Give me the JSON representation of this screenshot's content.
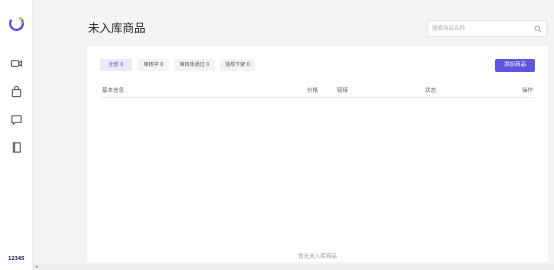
{
  "sidebar": {
    "nav": [
      {
        "icon": "video-icon"
      },
      {
        "icon": "shopping-bag-icon"
      },
      {
        "icon": "message-icon"
      },
      {
        "icon": "book-icon"
      }
    ],
    "avatar_text": "12345"
  },
  "header": {
    "title": "未入库商品",
    "search_placeholder": "搜索商品名称"
  },
  "tabs": [
    {
      "label": "全部 0",
      "active": true
    },
    {
      "label": "审核中 0",
      "active": false
    },
    {
      "label": "审核未通过 0",
      "active": false
    },
    {
      "label": "违规下架 0",
      "active": false
    }
  ],
  "add_button": "添加商品",
  "table": {
    "columns": [
      "基本信息",
      "价格",
      "链接",
      "状态",
      "操作"
    ]
  },
  "empty_text": "暂无未入库商品",
  "colors": {
    "accent": "#5f55de"
  }
}
